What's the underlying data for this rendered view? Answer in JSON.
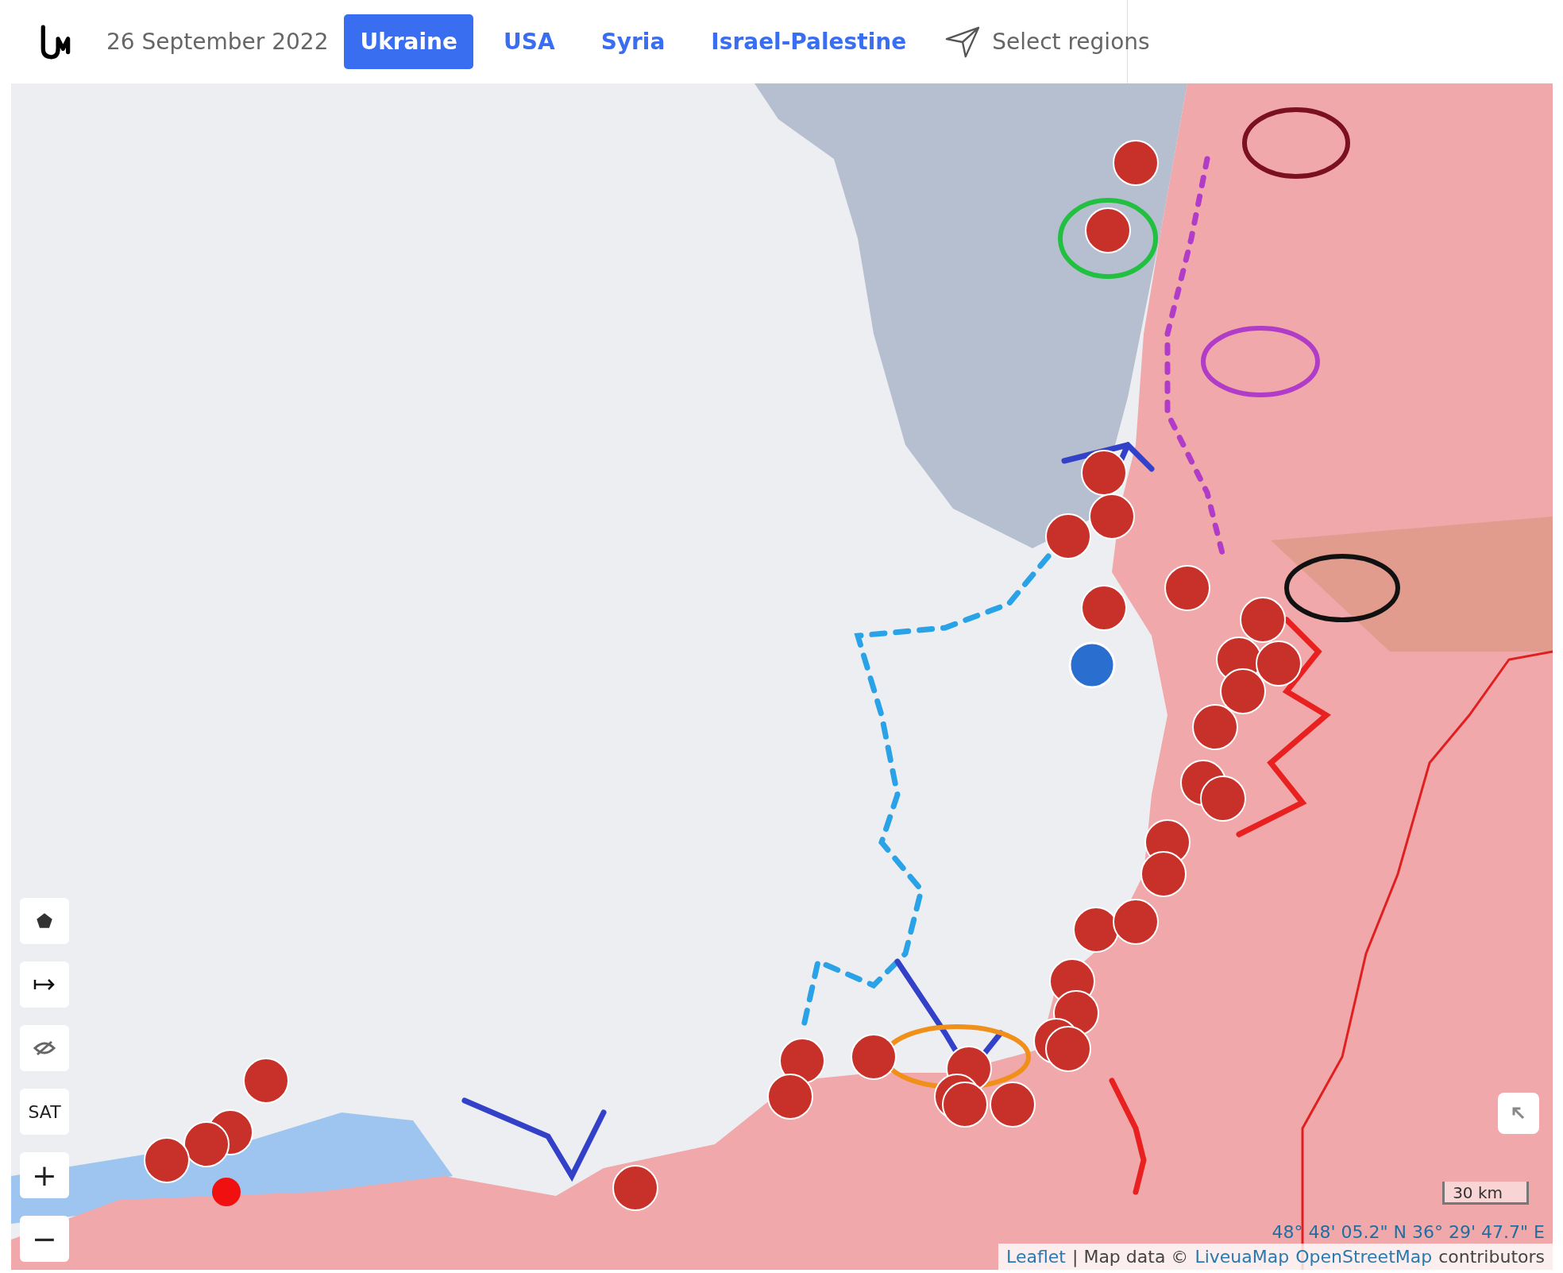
{
  "header": {
    "date": "26 September 2022",
    "tabs": [
      {
        "label": "Ukraine",
        "selected": true
      },
      {
        "label": "USA",
        "selected": false
      },
      {
        "label": "Syria",
        "selected": false
      },
      {
        "label": "Israel-Palestine",
        "selected": false
      }
    ],
    "select_regions": "Select regions"
  },
  "map": {
    "controls": [
      {
        "kind": "polygon"
      },
      {
        "kind": "measure"
      },
      {
        "kind": "hide"
      },
      {
        "kind": "text",
        "label": "SAT"
      },
      {
        "kind": "text",
        "label": "+"
      },
      {
        "kind": "text",
        "label": "−"
      }
    ],
    "scale": "30 km",
    "coordinates": "48° 48' 05.2\" N 36° 29' 47.7\" E",
    "attribution": {
      "leaflet": "Leaflet",
      "separator": "| Map data ©",
      "liveuamap": "LiveuaMap",
      "osm": "OpenStreetMap",
      "tail": "contributors"
    }
  }
}
